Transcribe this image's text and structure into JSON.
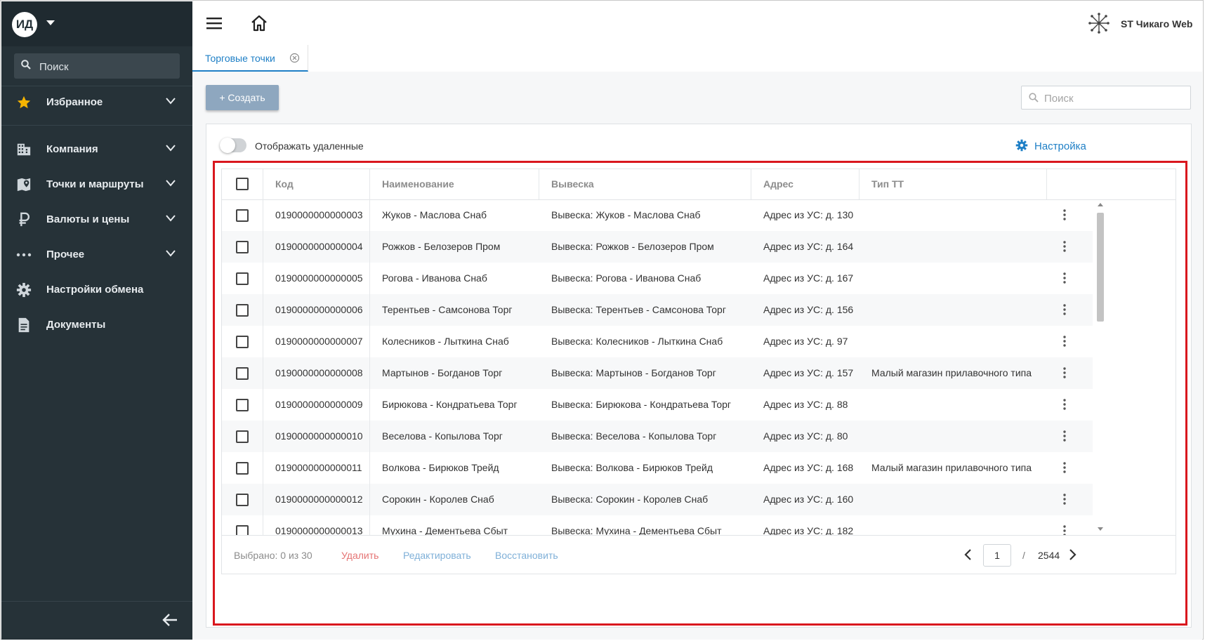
{
  "sidebar": {
    "avatar": "ИД",
    "search_placeholder": "Поиск",
    "items": [
      {
        "label": "Избранное"
      },
      {
        "label": "Компания"
      },
      {
        "label": "Точки и маршруты"
      },
      {
        "label": "Валюты и цены"
      },
      {
        "label": "Прочее"
      },
      {
        "label": "Настройки обмена"
      },
      {
        "label": "Документы"
      }
    ]
  },
  "header": {
    "brand": "ST Чикаго Web"
  },
  "tabs": [
    {
      "label": "Торговые точки"
    }
  ],
  "toolbar": {
    "create_label": "+ Создать",
    "search_placeholder": "Поиск"
  },
  "panel": {
    "toggle_label": "Отображать удаленные",
    "settings_label": "Настройка"
  },
  "table": {
    "columns": [
      "Код",
      "Наименование",
      "Вывеска",
      "Адрес",
      "Тип ТТ"
    ],
    "rows": [
      {
        "code": "0190000000000003",
        "name": "Жуков - Маслова Снаб",
        "sign": "Вывеска: Жуков - Маслова Снаб",
        "address": "Адрес из УС: д. 130",
        "type": ""
      },
      {
        "code": "0190000000000004",
        "name": "Рожков - Белозеров Пром",
        "sign": "Вывеска: Рожков - Белозеров Пром",
        "address": "Адрес из УС: д. 164",
        "type": ""
      },
      {
        "code": "0190000000000005",
        "name": "Рогова - Иванова Снаб",
        "sign": "Вывеска: Рогова - Иванова Снаб",
        "address": "Адрес из УС: д. 167",
        "type": ""
      },
      {
        "code": "0190000000000006",
        "name": "Терентьев - Самсонова Торг",
        "sign": "Вывеска: Терентьев - Самсонова Торг",
        "address": "Адрес из УС: д. 156",
        "type": ""
      },
      {
        "code": "0190000000000007",
        "name": "Колесников - Лыткина Снаб",
        "sign": "Вывеска: Колесников - Лыткина Снаб",
        "address": "Адрес из УС: д. 97",
        "type": ""
      },
      {
        "code": "0190000000000008",
        "name": "Мартынов - Богданов Торг",
        "sign": "Вывеска: Мартынов - Богданов Торг",
        "address": "Адрес из УС: д. 157",
        "type": "Малый магазин прилавочного типа"
      },
      {
        "code": "0190000000000009",
        "name": "Бирюкова - Кондратьева Торг",
        "sign": "Вывеска: Бирюкова - Кондратьева Торг",
        "address": "Адрес из УС: д. 88",
        "type": ""
      },
      {
        "code": "0190000000000010",
        "name": "Веселова - Копылова Торг",
        "sign": "Вывеска: Веселова - Копылова Торг",
        "address": "Адрес из УС: д. 80",
        "type": ""
      },
      {
        "code": "0190000000000011",
        "name": "Волкова - Бирюков Трейд",
        "sign": "Вывеска: Волкова - Бирюков Трейд",
        "address": "Адрес из УС: д. 168",
        "type": "Малый магазин прилавочного типа"
      },
      {
        "code": "0190000000000012",
        "name": "Сорокин - Королев Снаб",
        "sign": "Вывеска: Сорокин - Королев Снаб",
        "address": "Адрес из УС: д. 160",
        "type": ""
      },
      {
        "code": "0190000000000013",
        "name": "Мухина - Дементьева Сбыт",
        "sign": "Вывеска: Мухина - Дементьева Сбыт",
        "address": "Адрес из УС: д. 182",
        "type": ""
      }
    ]
  },
  "footer": {
    "selected": "Выбрано: 0 из 30",
    "delete_label": "Удалить",
    "edit_label": "Редактировать",
    "restore_label": "Восстановить",
    "page": "1",
    "page_sep": "/",
    "total_pages": "2544"
  },
  "colors": {
    "sidebar_bg": "#263238",
    "accent": "#1e7fc6",
    "highlight": "#d9171e",
    "delete": "#e57373",
    "disabled_action": "#7fb0d8",
    "star": "#f5b400"
  }
}
